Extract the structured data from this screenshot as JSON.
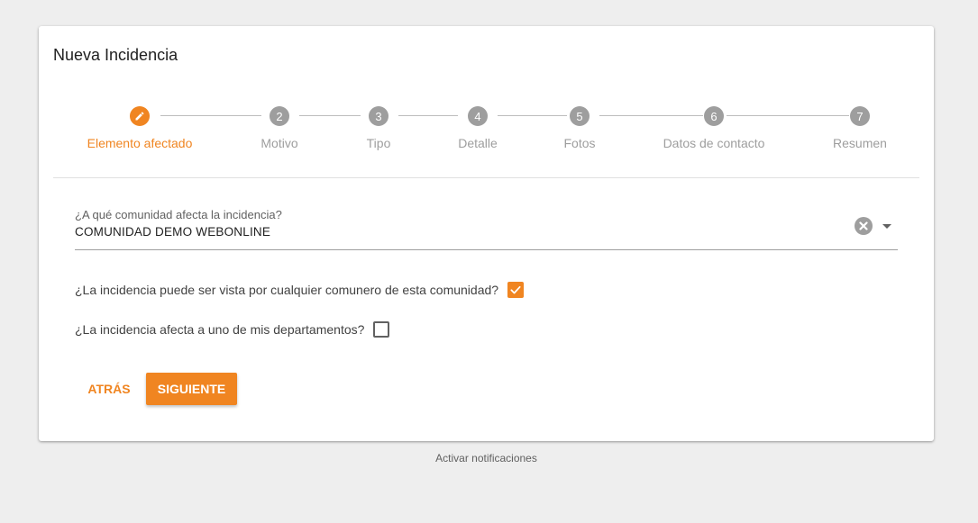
{
  "card": {
    "title": "Nueva Incidencia"
  },
  "stepper": {
    "steps": [
      {
        "number": "",
        "label": "Elemento afectado",
        "state": "active",
        "icon": "pencil-icon"
      },
      {
        "number": "2",
        "label": "Motivo",
        "state": "pending"
      },
      {
        "number": "3",
        "label": "Tipo",
        "state": "pending"
      },
      {
        "number": "4",
        "label": "Detalle",
        "state": "pending"
      },
      {
        "number": "5",
        "label": "Fotos",
        "state": "pending"
      },
      {
        "number": "6",
        "label": "Datos de contacto",
        "state": "pending"
      },
      {
        "number": "7",
        "label": "Resumen",
        "state": "pending"
      }
    ]
  },
  "form": {
    "community": {
      "label": "¿A qué comunidad afecta la incidencia?",
      "value": "COMUNIDAD DEMO WEBONLINE"
    },
    "visible_to_all": {
      "label": "¿La incidencia puede ser vista por cualquier comunero de esta comunidad?",
      "checked": true
    },
    "affects_my_department": {
      "label": "¿La incidencia afecta a uno de mis departamentos?",
      "checked": false
    }
  },
  "actions": {
    "back_label": "ATRÁS",
    "next_label": "SIGUIENTE"
  },
  "footer": {
    "notifications_link": "Activar notificaciones"
  },
  "colors": {
    "accent": "#f08521",
    "inactive": "#9e9e9e",
    "background": "#eeeeee"
  }
}
